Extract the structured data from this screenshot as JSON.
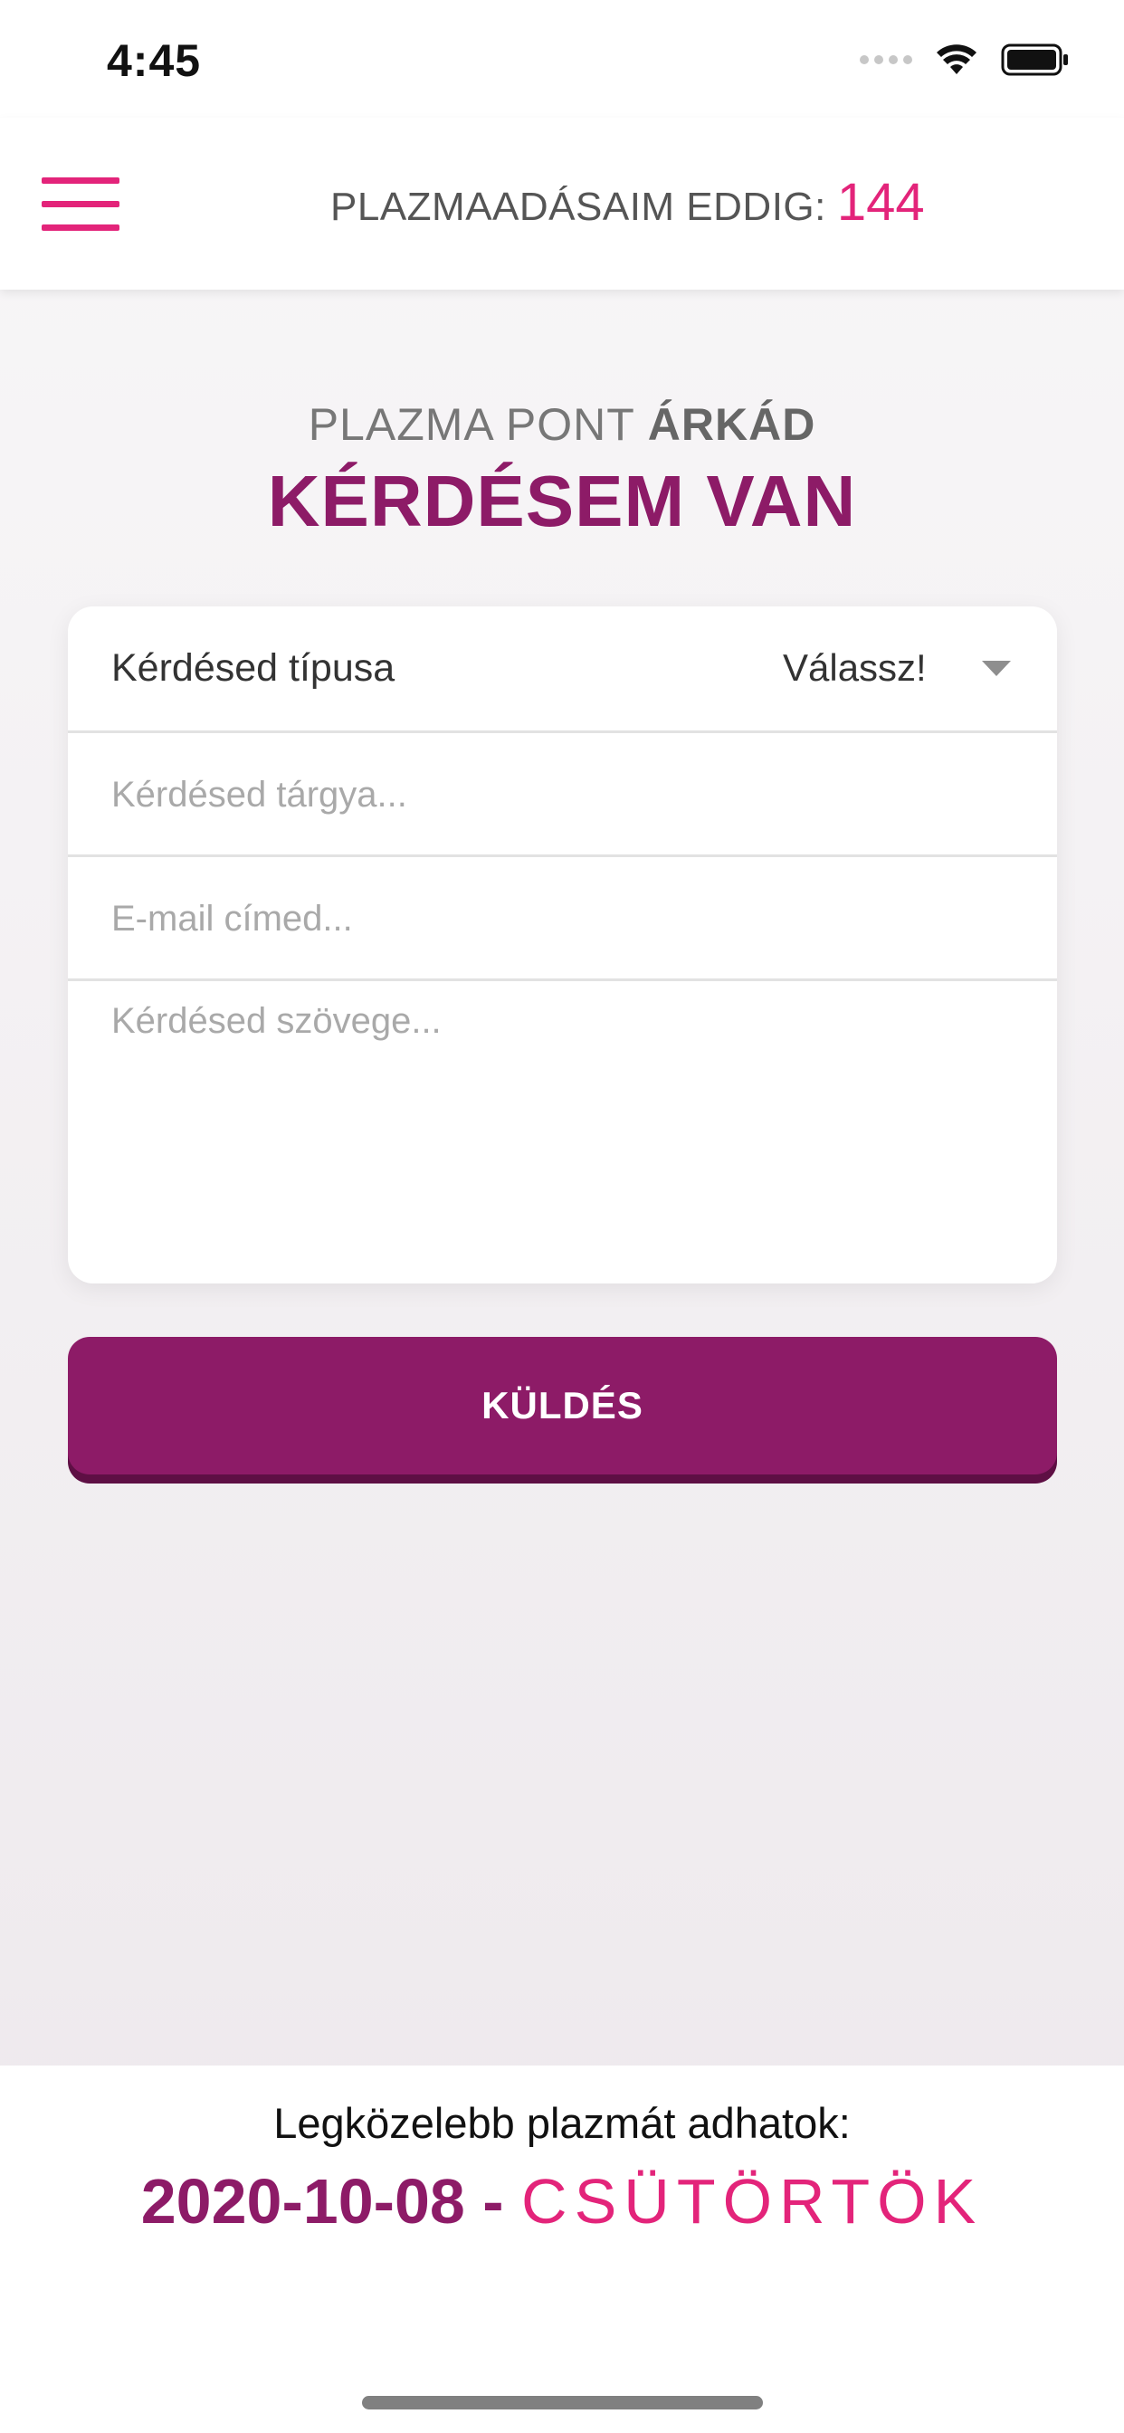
{
  "status_bar": {
    "time": "4:45"
  },
  "header": {
    "donations_label": "PLAZMAADÁSAIM EDDIG:",
    "donations_count": "144",
    "menu_icon": "hamburger-menu-icon"
  },
  "page": {
    "location_prefix": "PLAZMA PONT",
    "location_name": "ÁRKÁD",
    "title": "KÉRDÉSEM VAN"
  },
  "form": {
    "type_label": "Kérdésed típusa",
    "type_value": "Válassz!",
    "subject_placeholder": "Kérdésed tárgya...",
    "email_placeholder": "E-mail címed...",
    "message_placeholder": "Kérdésed szövege...",
    "submit_label": "KÜLDÉS"
  },
  "next_donation": {
    "label": "Legközelebb plazmát adhatok:",
    "date": "2020-10-08",
    "separator": "-",
    "weekday": "CSÜTÖRTÖK"
  },
  "colors": {
    "accent_pink": "#e3247a",
    "primary_purple": "#8d1b67"
  }
}
